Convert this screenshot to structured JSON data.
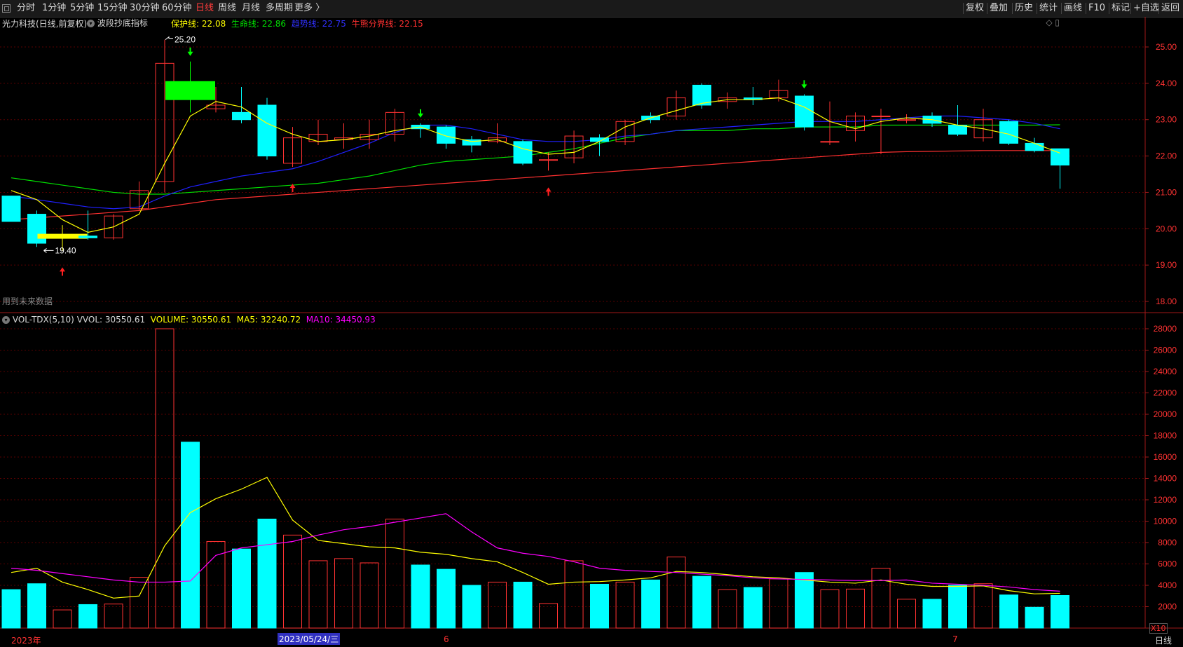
{
  "toolbar": {
    "periods": [
      "分时",
      "1分钟",
      "5分钟",
      "15分钟",
      "30分钟",
      "60分钟",
      "日线",
      "周线",
      "月线",
      "多周期",
      "更多 〉"
    ],
    "active_period": "日线",
    "right_items": [
      "复权",
      "叠加",
      "历史",
      "统计",
      "画线",
      "F10",
      "标记",
      "+自选",
      "返回"
    ]
  },
  "header": {
    "stock": "光力科技(日线,前复权)",
    "indicator": "波段抄底指标",
    "lines": [
      {
        "label": "保护线: 22.08",
        "color": "#ffff00"
      },
      {
        "label": "生命线: 22.86",
        "color": "#00e000"
      },
      {
        "label": "趋势线: 22.75",
        "color": "#2020ff"
      },
      {
        "label": "牛熊分界线: 22.15",
        "color": "#ff3030"
      }
    ],
    "future_note": "用到未来数据"
  },
  "volume_header": {
    "name": "VOL-TDX(5,10)",
    "vvol": "VVOL: 30550.61",
    "volume": "VOLUME: 30550.61",
    "ma5": "MA5: 32240.72",
    "ma10": "MA10: 34450.93"
  },
  "axis": {
    "price_ticks": [
      "25.00",
      "24.00",
      "23.00",
      "22.00",
      "21.00",
      "20.00",
      "19.00",
      "18.00"
    ],
    "volume_ticks": [
      "28000",
      "26000",
      "24000",
      "22000",
      "20000",
      "18000",
      "16000",
      "14000",
      "12000",
      "10000",
      "8000",
      "6000",
      "4000",
      "2000"
    ],
    "volume_unit": "X10",
    "period_label": "日线",
    "date_labels": [
      "2023年",
      "2023/05/24/三",
      "6",
      "7"
    ]
  },
  "annotations": {
    "high": "25.20",
    "low": "19.40"
  },
  "colors": {
    "up": "#ff3232",
    "down": "#00ffff",
    "grid": "#5a0000",
    "protect": "#ffff00",
    "life": "#00e000",
    "trend": "#2020ff",
    "bull": "#ff3030",
    "ma10": "#ff00ff"
  },
  "chart_data": {
    "type": "candlestick",
    "price_ylim": [
      17.8,
      25.5
    ],
    "volume_ylim": [
      0,
      29000
    ],
    "candles": [
      {
        "o": 20.9,
        "c": 20.2,
        "h": 20.9,
        "l": 20.2,
        "v": 3600
      },
      {
        "o": 20.4,
        "c": 19.6,
        "h": 20.5,
        "l": 19.5,
        "v": 4150
      },
      {
        "o": 19.8,
        "c": 19.8,
        "h": 20.1,
        "l": 19.4,
        "v": 1700,
        "mark": "yellow"
      },
      {
        "o": 19.8,
        "c": 19.75,
        "h": 20.5,
        "l": 19.7,
        "v": 2200
      },
      {
        "o": 19.75,
        "c": 20.35,
        "h": 20.4,
        "l": 19.7,
        "v": 2250
      },
      {
        "o": 20.55,
        "c": 21.05,
        "h": 21.3,
        "l": 20.5,
        "v": 4750
      },
      {
        "o": 21.3,
        "c": 24.55,
        "h": 25.2,
        "l": 21.0,
        "v": 28000
      },
      {
        "o": 24.1,
        "c": 23.5,
        "h": 24.6,
        "l": 23.2,
        "v": 17400,
        "mark": "green"
      },
      {
        "o": 23.3,
        "c": 23.4,
        "h": 23.9,
        "l": 23.2,
        "v": 8100
      },
      {
        "o": 23.2,
        "c": 23.0,
        "h": 23.9,
        "l": 22.9,
        "v": 7400
      },
      {
        "o": 23.4,
        "c": 22.0,
        "h": 23.6,
        "l": 21.9,
        "v": 10200
      },
      {
        "o": 21.8,
        "c": 22.5,
        "h": 22.8,
        "l": 21.7,
        "v": 8700
      },
      {
        "o": 22.4,
        "c": 22.6,
        "h": 23.0,
        "l": 22.3,
        "v": 6300
      },
      {
        "o": 22.45,
        "c": 22.5,
        "h": 22.9,
        "l": 22.2,
        "v": 6500
      },
      {
        "o": 22.45,
        "c": 22.6,
        "h": 23.0,
        "l": 22.2,
        "v": 6100
      },
      {
        "o": 22.6,
        "c": 23.2,
        "h": 23.3,
        "l": 22.4,
        "v": 10200
      },
      {
        "o": 22.85,
        "c": 22.75,
        "h": 22.9,
        "l": 22.5,
        "v": 5900
      },
      {
        "o": 22.8,
        "c": 22.35,
        "h": 22.85,
        "l": 22.2,
        "v": 5500
      },
      {
        "o": 22.45,
        "c": 22.3,
        "h": 22.55,
        "l": 22.1,
        "v": 4000
      },
      {
        "o": 22.4,
        "c": 22.5,
        "h": 22.9,
        "l": 22.35,
        "v": 4300
      },
      {
        "o": 22.4,
        "c": 21.8,
        "h": 22.45,
        "l": 21.75,
        "v": 4300
      },
      {
        "o": 21.9,
        "c": 21.9,
        "h": 22.1,
        "l": 21.6,
        "v": 2300
      },
      {
        "o": 21.95,
        "c": 22.55,
        "h": 22.7,
        "l": 21.8,
        "v": 6300
      },
      {
        "o": 22.5,
        "c": 22.4,
        "h": 22.6,
        "l": 22.0,
        "v": 4100
      },
      {
        "o": 22.4,
        "c": 22.95,
        "h": 23.0,
        "l": 22.3,
        "v": 4300
      },
      {
        "o": 23.1,
        "c": 23.0,
        "h": 23.2,
        "l": 22.9,
        "v": 4500
      },
      {
        "o": 23.1,
        "c": 23.6,
        "h": 23.8,
        "l": 23.0,
        "v": 6650
      },
      {
        "o": 23.95,
        "c": 23.4,
        "h": 24.0,
        "l": 23.3,
        "v": 4850
      },
      {
        "o": 23.5,
        "c": 23.6,
        "h": 23.75,
        "l": 23.3,
        "v": 3600
      },
      {
        "o": 23.6,
        "c": 23.55,
        "h": 23.9,
        "l": 23.4,
        "v": 3800
      },
      {
        "o": 23.6,
        "c": 23.8,
        "h": 24.1,
        "l": 23.5,
        "v": 4600
      },
      {
        "o": 23.65,
        "c": 22.8,
        "h": 23.7,
        "l": 22.7,
        "v": 5200
      },
      {
        "o": 22.4,
        "c": 22.4,
        "h": 23.5,
        "l": 22.3,
        "v": 3600
      },
      {
        "o": 22.7,
        "c": 23.1,
        "h": 23.2,
        "l": 22.4,
        "v": 3650
      },
      {
        "o": 23.1,
        "c": 23.1,
        "h": 23.3,
        "l": 22.05,
        "v": 5600
      },
      {
        "o": 23.0,
        "c": 23.0,
        "h": 23.15,
        "l": 22.9,
        "v": 2700
      },
      {
        "o": 23.1,
        "c": 22.9,
        "h": 23.2,
        "l": 22.8,
        "v": 2700
      },
      {
        "o": 22.85,
        "c": 22.6,
        "h": 23.4,
        "l": 22.55,
        "v": 4000
      },
      {
        "o": 22.5,
        "c": 23.0,
        "h": 23.3,
        "l": 22.4,
        "v": 4150
      },
      {
        "o": 22.95,
        "c": 22.35,
        "h": 23.0,
        "l": 22.3,
        "v": 3100
      },
      {
        "o": 22.35,
        "c": 22.15,
        "h": 22.5,
        "l": 22.1,
        "v": 1950
      },
      {
        "o": 22.2,
        "c": 21.75,
        "h": 22.2,
        "l": 21.1,
        "v": 3050
      }
    ],
    "ma5_volume": [
      5200,
      5600,
      4300,
      3600,
      2800,
      3000,
      7700,
      10800,
      12100,
      13000,
      14100,
      10100,
      8200,
      7900,
      7600,
      7500,
      7100,
      6900,
      6500,
      6200,
      5200,
      4100,
      4300,
      4350,
      4500,
      4700,
      5300,
      5200,
      5000,
      4800,
      4700,
      4500,
      4300,
      4200,
      4500,
      4100,
      3900,
      3900,
      3950,
      3500,
      3200,
      3250
    ],
    "ma10_volume": [
      5600,
      5400,
      5100,
      4800,
      4500,
      4300,
      4300,
      4400,
      6800,
      7500,
      7800,
      8100,
      8700,
      9200,
      9500,
      9900,
      10300,
      10700,
      9000,
      7500,
      7000,
      6700,
      6200,
      5600,
      5400,
      5300,
      5200,
      5050,
      4900,
      4700,
      4600,
      4550,
      4500,
      4450,
      4450,
      4500,
      4200,
      4100,
      4000,
      3850,
      3600,
      3450
    ],
    "protect_line": [
      21.05,
      20.8,
      20.25,
      19.9,
      20.05,
      20.4,
      21.8,
      23.1,
      23.5,
      23.35,
      22.9,
      22.6,
      22.4,
      22.45,
      22.55,
      22.7,
      22.8,
      22.55,
      22.4,
      22.45,
      22.2,
      22.05,
      22.1,
      22.4,
      22.8,
      23.05,
      23.25,
      23.45,
      23.55,
      23.55,
      23.6,
      23.35,
      22.95,
      22.75,
      22.95,
      23.05,
      23.0,
      22.85,
      22.75,
      22.6,
      22.35,
      22.08
    ],
    "trend_line": [
      20.9,
      20.8,
      20.7,
      20.6,
      20.55,
      20.6,
      20.9,
      21.15,
      21.3,
      21.45,
      21.55,
      21.65,
      21.85,
      22.1,
      22.35,
      22.65,
      22.85,
      22.85,
      22.75,
      22.6,
      22.45,
      22.4,
      22.4,
      22.45,
      22.55,
      22.6,
      22.7,
      22.75,
      22.8,
      22.85,
      22.9,
      22.95,
      22.95,
      22.95,
      23.0,
      23.05,
      23.1,
      23.1,
      23.05,
      23.0,
      22.9,
      22.75
    ],
    "life_line": [
      21.4,
      21.3,
      21.2,
      21.1,
      21.0,
      20.95,
      20.95,
      21.0,
      21.05,
      21.1,
      21.15,
      21.2,
      21.25,
      21.35,
      21.45,
      21.6,
      21.75,
      21.85,
      21.9,
      21.95,
      22.0,
      22.1,
      22.2,
      22.35,
      22.5,
      22.6,
      22.7,
      22.7,
      22.7,
      22.75,
      22.75,
      22.8,
      22.8,
      22.8,
      22.85,
      22.85,
      22.85,
      22.85,
      22.85,
      22.85,
      22.85,
      22.86
    ],
    "bull_bear_line": [
      20.25,
      20.3,
      20.35,
      20.4,
      20.45,
      20.5,
      20.6,
      20.7,
      20.8,
      20.85,
      20.9,
      20.95,
      21.0,
      21.05,
      21.1,
      21.15,
      21.2,
      21.25,
      21.3,
      21.35,
      21.4,
      21.45,
      21.5,
      21.55,
      21.6,
      21.65,
      21.7,
      21.75,
      21.8,
      21.85,
      21.9,
      21.95,
      22.0,
      22.05,
      22.1,
      22.12,
      22.13,
      22.14,
      22.15,
      22.15,
      22.15,
      22.15
    ],
    "buy_signals": [
      2,
      11,
      21
    ],
    "sell_signals": [
      7,
      16,
      31
    ]
  }
}
